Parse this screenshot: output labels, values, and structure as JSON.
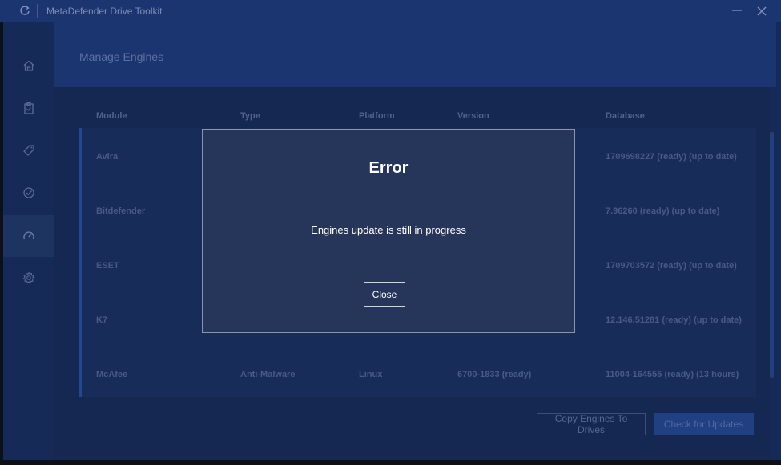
{
  "window": {
    "title": "MetaDefender Drive Toolkit"
  },
  "header": {
    "title": "Manage Engines"
  },
  "sidebar": {
    "items": [
      {
        "icon": "home-icon"
      },
      {
        "icon": "clipboard-icon"
      },
      {
        "icon": "tag-icon"
      },
      {
        "icon": "shield-check-icon"
      },
      {
        "icon": "gauge-icon",
        "active": true
      },
      {
        "icon": "gear-icon"
      }
    ]
  },
  "table": {
    "columns": [
      "Module",
      "Type",
      "Platform",
      "Version",
      "Database"
    ],
    "rows": [
      {
        "module": "Avira",
        "type": "",
        "platform": "",
        "version": "",
        "database": "1709698227 (ready) (up to date)"
      },
      {
        "module": "Bitdefender",
        "type": "",
        "platform": "",
        "version": "",
        "database": "7.96260 (ready) (up to date)"
      },
      {
        "module": "ESET",
        "type": "",
        "platform": "",
        "version": "",
        "database": "1709703572 (ready) (up to date)"
      },
      {
        "module": "K7",
        "type": "",
        "platform": "",
        "version": "",
        "database": "12.146.51281 (ready) (up to date)"
      },
      {
        "module": "McAfee",
        "type": "Anti-Malware",
        "platform": "Linux",
        "version": "6700-1833 (ready)",
        "database": "11004-164555 (ready) (13 hours)"
      }
    ]
  },
  "actions": {
    "copy_label": "Copy Engines To Drives",
    "check_label": "Check for Updates"
  },
  "dialog": {
    "title": "Error",
    "message": "Engines update is still in progress",
    "close_label": "Close"
  },
  "colors": {
    "accent": "#25478f",
    "dialog_bg": "#26355a",
    "dialog_text": "#ffffff"
  }
}
